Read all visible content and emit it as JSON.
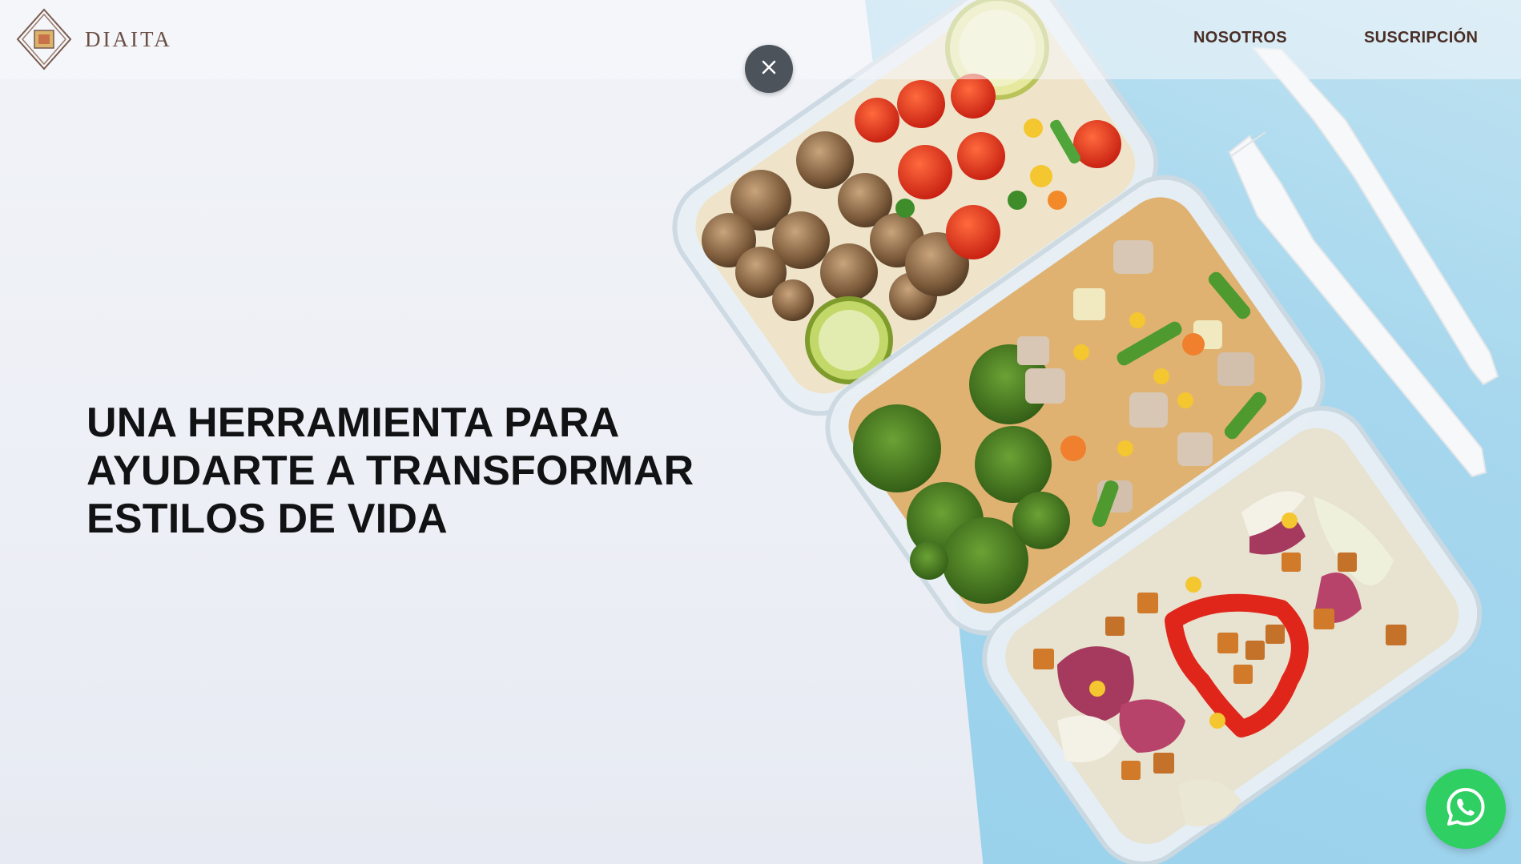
{
  "brand": {
    "name": "DIAITA",
    "logo_icon": "diamond-frame-logo"
  },
  "nav": {
    "items": [
      {
        "label": "NOSOTROS"
      },
      {
        "label": "SUSCRIPCIÓN"
      }
    ]
  },
  "hero": {
    "headline_lines": [
      "UNA HERRAMIENTA PARA",
      "AYUDARTE A TRANSFORMAR",
      "ESTILOS DE VIDA"
    ],
    "image": "meal-prep-containers-photo"
  },
  "controls": {
    "close_icon": "close-icon",
    "whatsapp_icon": "whatsapp-icon"
  },
  "colors": {
    "brand_text": "#6b4f45",
    "nav_text": "#4a2f27",
    "headline": "#111214",
    "close_button_bg": "#4d535b",
    "whatsapp_green": "#2fcf63",
    "table_blue": "#a6d7ee"
  }
}
